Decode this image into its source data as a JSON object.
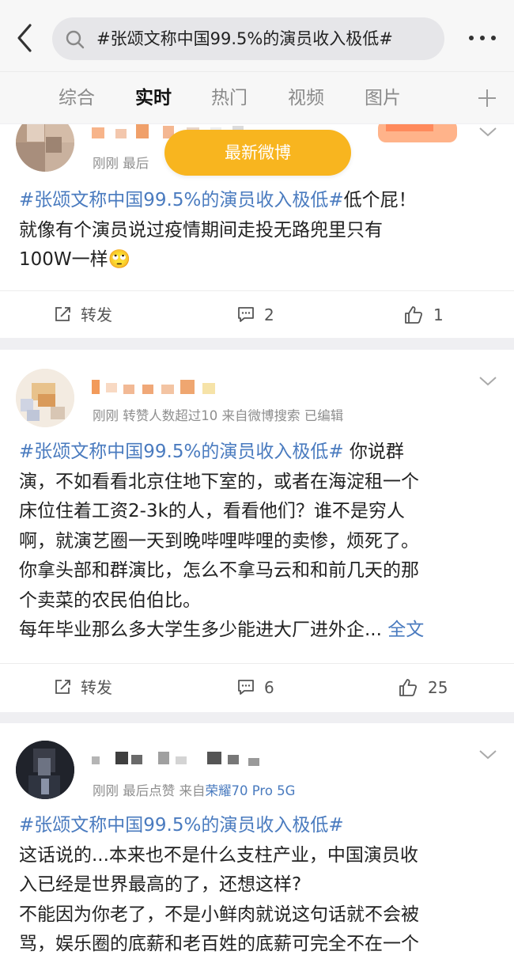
{
  "header": {
    "search_query": "#张颂文称中国99.5%的演员收入极低#",
    "search_icon": "search-icon",
    "back_icon": "chevron-left-icon",
    "more_icon": "more-dots-icon"
  },
  "tabs": [
    {
      "label": "综合",
      "active": false
    },
    {
      "label": "实时",
      "active": true
    },
    {
      "label": "热门",
      "active": false
    },
    {
      "label": "视频",
      "active": false
    },
    {
      "label": "图片",
      "active": false
    }
  ],
  "colors": {
    "accent_blue": "#4a7bbf",
    "pill_orange": "#f8b51f",
    "active_tab": "#111111",
    "inactive_tab": "#8a8a8a"
  },
  "new_posts_pill": "最新微博",
  "posts": [
    {
      "meta_prefix": "刚刚  最后",
      "topic": "#张颂文称中国99.5%的演员收入极低#",
      "lines": [
        "低个屁！",
        "就像有个演员说过疫情期间走投无路兜里只有",
        "100W一样🙄"
      ],
      "actions": {
        "repost": "转发",
        "comments": "2",
        "likes": "1"
      }
    },
    {
      "meta_prefix": "刚刚  转赞人数超过10  来自微博搜索  已编辑",
      "topic": "#张颂文称中国99.5%的演员收入极低#",
      "lines": [
        " 你说群",
        "演，不如看看北京住地下室的，或者在海淀租一个",
        "床位住着工资2-3k的人，看看他们？谁不是穷人",
        "啊，就演艺圈一天到晚哔哩哔哩的卖惨，烦死了。",
        "你拿头部和群演比，怎么不拿马云和和前几天的那",
        "个卖菜的农民伯伯比。",
        "每年毕业那么多大学生多少能进大厂进外企..."
      ],
      "full_text": "全文",
      "actions": {
        "repost": "转发",
        "comments": "6",
        "likes": "25"
      }
    },
    {
      "meta_prefix": "刚刚  最后点赞  来自",
      "meta_device": "荣耀70 Pro 5G",
      "topic": "#张颂文称中国99.5%的演员收入极低#",
      "lines": [
        "这话说的...本来也不是什么支柱产业，中国演员收",
        "入已经是世界最高的了，还想这样?",
        "不能因为你老了，不是小鲜肉就说这句话就不会被",
        "骂，娱乐圈的底薪和老百姓的底薪可完全不在一个"
      ]
    }
  ]
}
